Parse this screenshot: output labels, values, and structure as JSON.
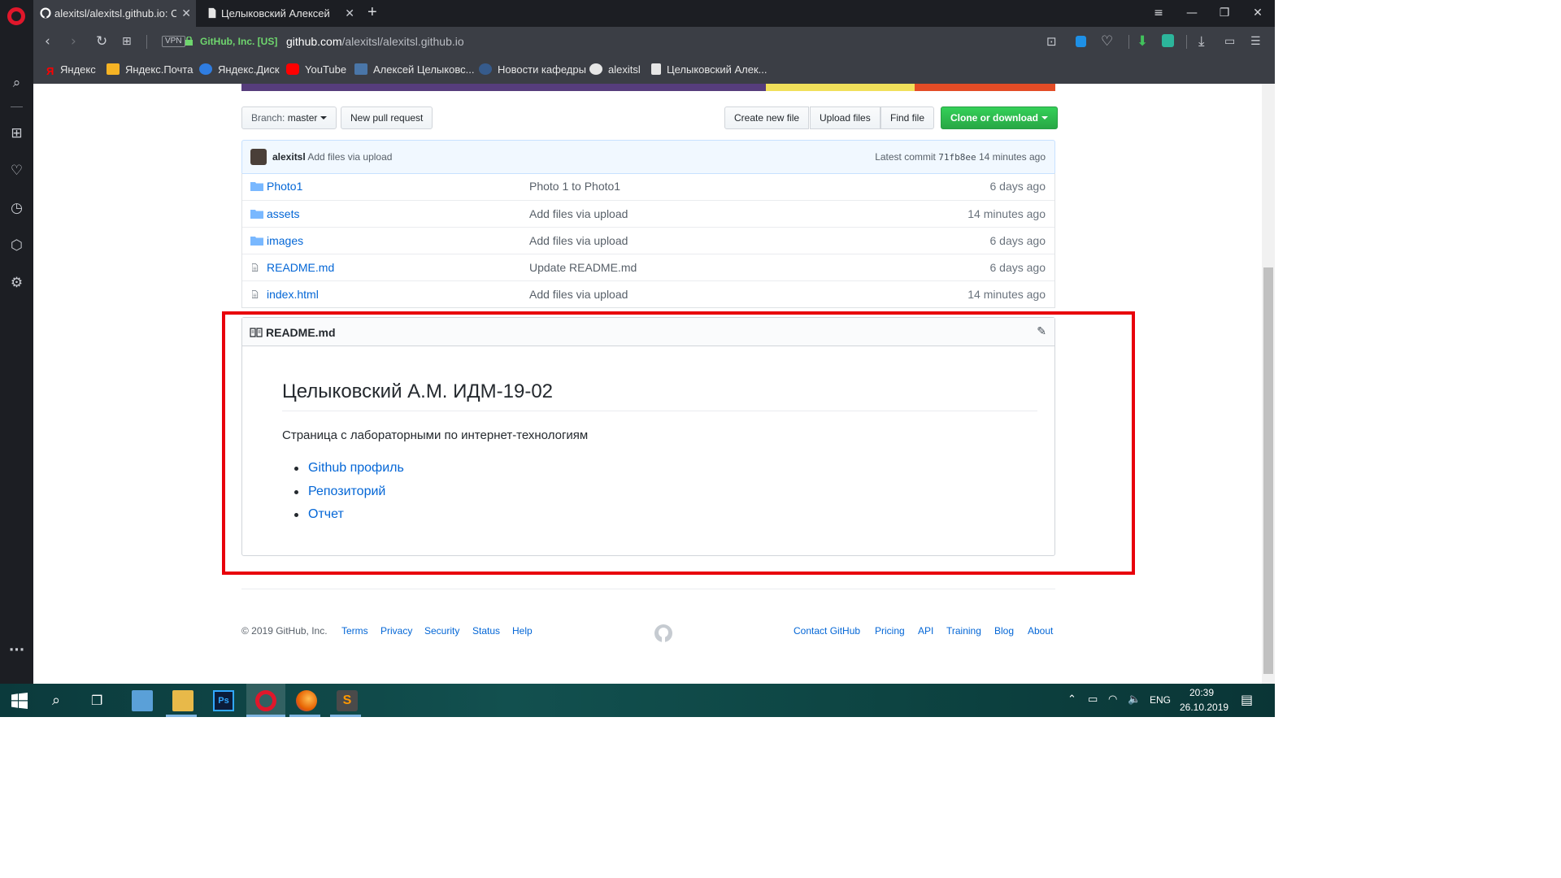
{
  "browser": {
    "tabs": [
      {
        "title": "alexitsl/alexitsl.github.io: Cт",
        "active": true
      },
      {
        "title": "Целыковский Алексей",
        "active": false
      }
    ],
    "new_tab_symbol": "+",
    "vpn_label": "VPN",
    "cert_label": "GitHub, Inc. [US]",
    "url_host": "github.com",
    "url_path": "/alexitsl/alexitsl.github.io",
    "bookmarks": [
      {
        "label": "Яндекс",
        "icon": "yandex-icon"
      },
      {
        "label": "Яндекс.Почта",
        "icon": "mail-icon"
      },
      {
        "label": "Яндекс.Диск",
        "icon": "disk-icon"
      },
      {
        "label": "YouTube",
        "icon": "youtube-icon"
      },
      {
        "label": "Алексей Целыковс...",
        "icon": "vk-icon"
      },
      {
        "label": "Новости кафедры",
        "icon": "gear-icon"
      },
      {
        "label": "alexitsl",
        "icon": "github-icon"
      },
      {
        "label": "Целыковский Алек...",
        "icon": "page-icon"
      }
    ]
  },
  "repo": {
    "branch_label": "Branch:",
    "branch_name": "master",
    "new_pull_request": "New pull request",
    "create_new_file": "Create new file",
    "upload_files": "Upload files",
    "find_file": "Find file",
    "clone_or_download": "Clone or download",
    "commit": {
      "author": "alexitsl",
      "message": "Add files via upload",
      "latest_label": "Latest commit",
      "sha": "71fb8ee",
      "age": "14 minutes ago"
    },
    "files": [
      {
        "name": "Photo1",
        "type": "folder",
        "message": "Photo 1 to Photo1",
        "age": "6 days ago"
      },
      {
        "name": "assets",
        "type": "folder",
        "message": "Add files via upload",
        "age": "14 minutes ago"
      },
      {
        "name": "images",
        "type": "folder",
        "message": "Add files via upload",
        "age": "6 days ago"
      },
      {
        "name": "README.md",
        "type": "file",
        "message": "Update README.md",
        "age": "6 days ago"
      },
      {
        "name": "index.html",
        "type": "file",
        "message": "Add files via upload",
        "age": "14 minutes ago"
      }
    ],
    "language_bar_colors": [
      "#563d7c",
      "#f1e05a",
      "#e34c26"
    ]
  },
  "readme": {
    "filename": "README.md",
    "heading": "Целыковский А.М. ИДМ-19-02",
    "paragraph": "Страница с лабораторными по интернет-технологиям",
    "links": [
      "Github профиль",
      "Репозиторий",
      "Отчет"
    ]
  },
  "footer": {
    "copyright": "© 2019 GitHub, Inc.",
    "left_links": [
      "Terms",
      "Privacy",
      "Security",
      "Status",
      "Help"
    ],
    "right_links": [
      "Contact GitHub",
      "Pricing",
      "API",
      "Training",
      "Blog",
      "About"
    ]
  },
  "taskbar": {
    "lang": "ENG",
    "time": "20:39",
    "date": "26.10.2019"
  },
  "colors": {
    "highlight": "#e8000b",
    "link": "#0366d6",
    "green": "#28a745"
  }
}
